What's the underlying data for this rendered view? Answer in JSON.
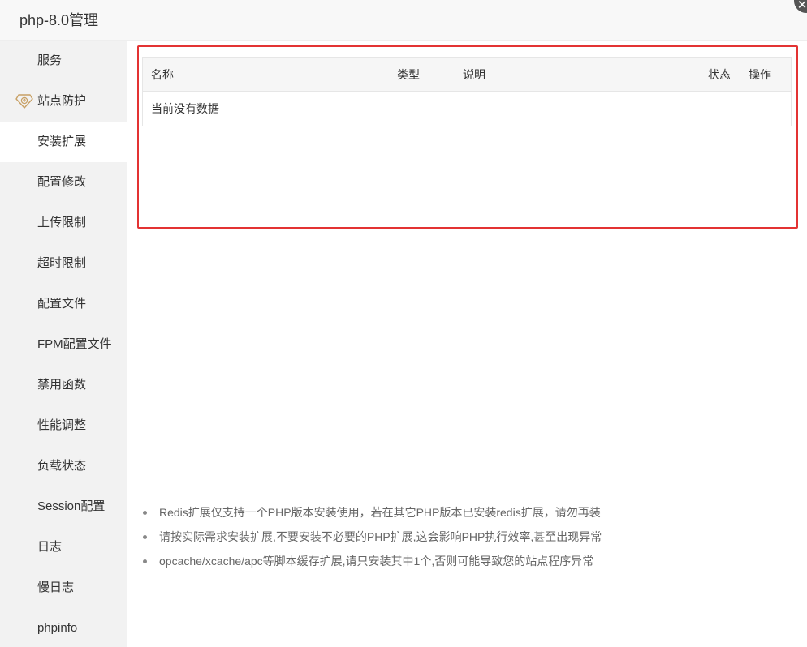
{
  "window": {
    "title": "php-8.0管理",
    "close_symbol": "✕"
  },
  "sidebar": {
    "items": [
      {
        "label": "服务"
      },
      {
        "label": "站点防护",
        "icon": "diamond-shield-icon"
      },
      {
        "label": "安装扩展",
        "active": true
      },
      {
        "label": "配置修改"
      },
      {
        "label": "上传限制"
      },
      {
        "label": "超时限制"
      },
      {
        "label": "配置文件"
      },
      {
        "label": "FPM配置文件"
      },
      {
        "label": "禁用函数"
      },
      {
        "label": "性能调整"
      },
      {
        "label": "负载状态"
      },
      {
        "label": "Session配置"
      },
      {
        "label": "日志"
      },
      {
        "label": "慢日志"
      },
      {
        "label": "phpinfo"
      }
    ]
  },
  "table": {
    "columns": [
      "名称",
      "类型",
      "说明",
      "状态",
      "操作"
    ],
    "empty_text": "当前没有数据"
  },
  "notes": [
    "Redis扩展仅支持一个PHP版本安装使用，若在其它PHP版本已安装redis扩展，请勿再装",
    "请按实际需求安装扩展,不要安装不必要的PHP扩展,这会影响PHP执行效率,甚至出现异常",
    "opcache/xcache/apc等脚本缓存扩展,请只安装其中1个,否则可能导致您的站点程序异常"
  ],
  "colors": {
    "highlight_border": "#e33333",
    "sidebar_bg": "#f2f2f2",
    "diamond_icon": "#c8a064"
  }
}
